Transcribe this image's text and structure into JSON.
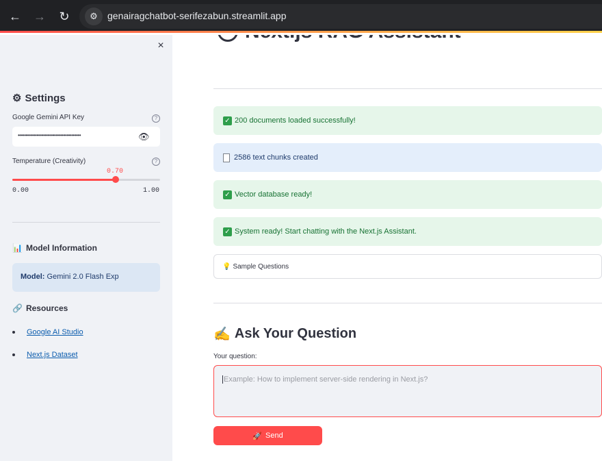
{
  "browser": {
    "url": "genairagchatbot-serifezabun.streamlit.app",
    "back_icon": "←",
    "forward_icon": "→",
    "reload_icon": "↻",
    "site_icon": "⚙"
  },
  "sidebar": {
    "close_icon": "×",
    "settings_title": "Settings",
    "settings_icon": "⚙",
    "api_key_label": "Google Gemini API Key",
    "api_key_value": "••••••••••••••••••••••••••••••••••••••••",
    "eye_icon": "👁",
    "temperature_label": "Temperature (Creativity)",
    "temperature_value": "0.70",
    "temperature_fraction": 0.7,
    "temperature_min": "0.00",
    "temperature_max": "1.00",
    "help_icon": "?",
    "model_info_title": "Model Information",
    "model_info_icon": "📊",
    "model_label": "Model:",
    "model_value": "Gemini 2.0 Flash Exp",
    "resources_title": "Resources",
    "resources_icon": "🔗",
    "resources": [
      {
        "label": "Google AI Studio"
      },
      {
        "label": "Next.js Dataset"
      }
    ]
  },
  "main": {
    "title": "Next.js RAG Assistant",
    "alerts": [
      {
        "type": "success",
        "icon": "✓",
        "text": "200 documents loaded successfully!"
      },
      {
        "type": "info",
        "icon": "",
        "text": "2586 text chunks created"
      },
      {
        "type": "success",
        "icon": "✓",
        "text": "Vector database ready!"
      },
      {
        "type": "success",
        "icon": "✓",
        "text": "System ready! Start chatting with the Next.js Assistant."
      }
    ],
    "sample_questions_icon": "💡",
    "sample_questions_label": "Sample Questions",
    "ask_title": "Ask Your Question",
    "ask_icon": "✍",
    "question_label": "Your question:",
    "question_placeholder": "Example: How to implement server-side rendering in Next.js?",
    "send_icon": "🚀",
    "send_label": "Send"
  },
  "colors": {
    "accent": "#ff4b4b",
    "sidebar_bg": "#f0f2f6",
    "success_bg": "#e6f6ea",
    "info_bg": "#e4eefb"
  }
}
